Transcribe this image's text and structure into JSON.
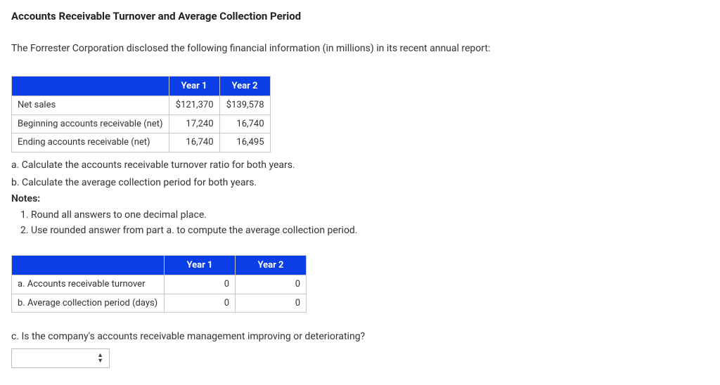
{
  "title": "Accounts Receivable Turnover and Average Collection Period",
  "intro": "The Forrester Corporation disclosed the following financial information (in millions) in its recent annual report:",
  "dataTable": {
    "headers": {
      "y1": "Year 1",
      "y2": "Year 2"
    },
    "rows": [
      {
        "label": "Net sales",
        "y1": "$121,370",
        "y2": "$139,578"
      },
      {
        "label": "Beginning accounts receivable (net)",
        "y1": "17,240",
        "y2": "16,740"
      },
      {
        "label": "Ending accounts receivable (net)",
        "y1": "16,740",
        "y2": "16,495"
      }
    ]
  },
  "questions": {
    "a": "a. Calculate the accounts receivable turnover ratio for both years.",
    "b": "b. Calculate the average collection period for both years.",
    "notesLabel": "Notes:",
    "notes": [
      "Round all answers to one decimal place.",
      "Use rounded answer from part a. to compute the average collection period."
    ]
  },
  "answerTable": {
    "headers": {
      "y1": "Year 1",
      "y2": "Year 2"
    },
    "rows": [
      {
        "label": "a. Accounts receivable turnover",
        "y1": "0",
        "y2": "0"
      },
      {
        "label": "b. Average collection period (days)",
        "y1": "0",
        "y2": "0"
      }
    ]
  },
  "partC": "c. Is the company's accounts receivable management improving or deteriorating?"
}
